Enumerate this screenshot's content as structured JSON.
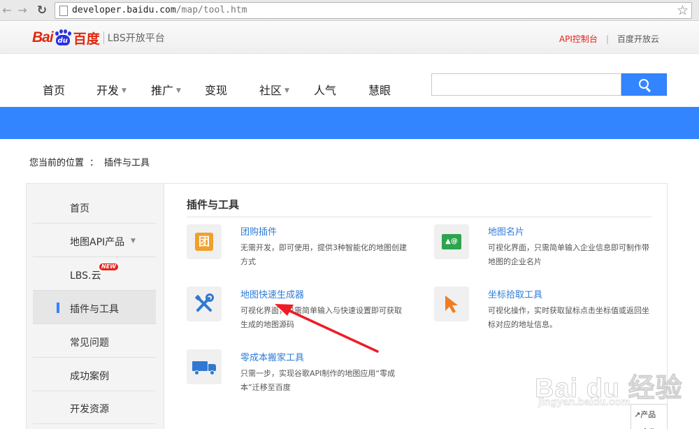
{
  "browser": {
    "url_host": "developer.baidu.com",
    "url_path": "/map/tool.htm"
  },
  "header": {
    "logo_bai": "Bai",
    "logo_du": "du",
    "logo_cn": "百度",
    "logo_sub": "LBS开放平台",
    "links": {
      "api_console": "API控制台",
      "divider": "|",
      "baidu_cloud": "百度开放云"
    }
  },
  "nav": {
    "items": [
      {
        "label": "首页",
        "dropdown": false
      },
      {
        "label": "开发",
        "dropdown": true
      },
      {
        "label": "推广",
        "dropdown": true
      },
      {
        "label": "变现",
        "dropdown": false
      },
      {
        "label": "社区",
        "dropdown": true
      },
      {
        "label": "人气",
        "dropdown": false
      },
      {
        "label": "慧眼",
        "dropdown": false
      }
    ],
    "search": {
      "value": "",
      "placeholder": ""
    }
  },
  "breadcrumb": {
    "prefix": "您当前的位置",
    "sep": "：",
    "current": "插件与工具"
  },
  "sidebar": {
    "items": [
      {
        "label": "首页"
      },
      {
        "label": "地图API产品"
      },
      {
        "label": "LBS.云",
        "badge": "NEW"
      },
      {
        "label": "插件与工具"
      },
      {
        "label": "常见问题"
      },
      {
        "label": "成功案例"
      },
      {
        "label": "开发资源"
      }
    ]
  },
  "main": {
    "title": "插件与工具",
    "tools": [
      {
        "name": "团购插件",
        "desc": "无需开发，即可使用，提供3种智能化的地图创建方式",
        "icon_glyph": "团"
      },
      {
        "name": "地图名片",
        "desc": "可视化界面，只需简单输入企业信息即可制作带地图的企业名片",
        "icon_glyph": "▲@"
      },
      {
        "name": "地图快速生成器",
        "desc": "可视化界面，只需简单输入与快速设置即可获取生成的地图源码"
      },
      {
        "name": "坐标拾取工具",
        "desc": "可视化操作，实时获取鼠标点击坐标值或返回坐标对应的地址信息。"
      },
      {
        "name": "零成本搬家工具",
        "desc": "只需一步，实现谷歌API制作的地图应用“零成本”迁移至百度"
      }
    ]
  },
  "watermark": {
    "text": "Bai du 经验",
    "url": "jingyan.baidu.com"
  },
  "float_panel": {
    "item1": "产品",
    "item2": "合作"
  },
  "colors": {
    "accent": "#3385ff",
    "brand_red": "#de2910",
    "link": "#2c7cd8",
    "arrow": "#ee1c24"
  }
}
